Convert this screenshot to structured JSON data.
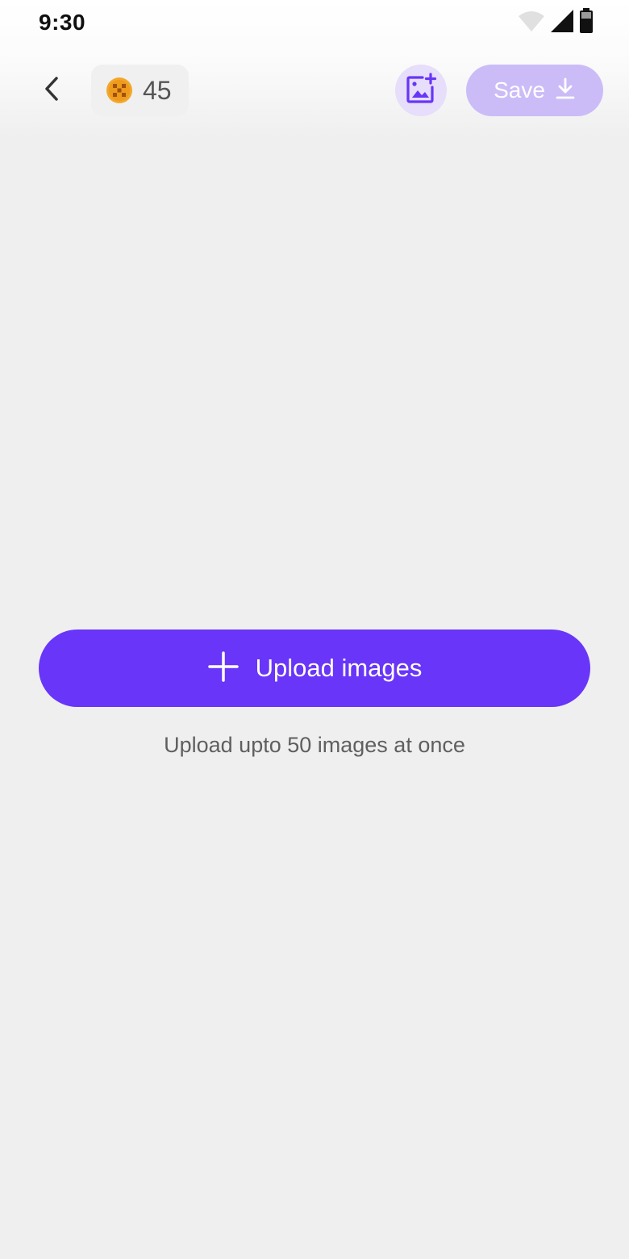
{
  "status_bar": {
    "time": "9:30",
    "icons": [
      "wifi-icon",
      "cell-signal-icon",
      "battery-icon"
    ]
  },
  "toolbar": {
    "back_icon": "chevron-left-icon",
    "credits": {
      "icon": "coin-icon",
      "count": "45"
    },
    "add_image_icon": "add-photo-icon",
    "save_label": "Save",
    "save_icon": "download-icon"
  },
  "main": {
    "upload_button_label": "Upload images",
    "upload_icon": "plus-icon",
    "upload_hint": "Upload upto 50 images at once"
  },
  "colors": {
    "accent": "#6935f8",
    "save_disabled": "#cbbcf8",
    "add_image_bg": "#e6defa",
    "coin": "#f2a72b",
    "background": "#efefef"
  }
}
